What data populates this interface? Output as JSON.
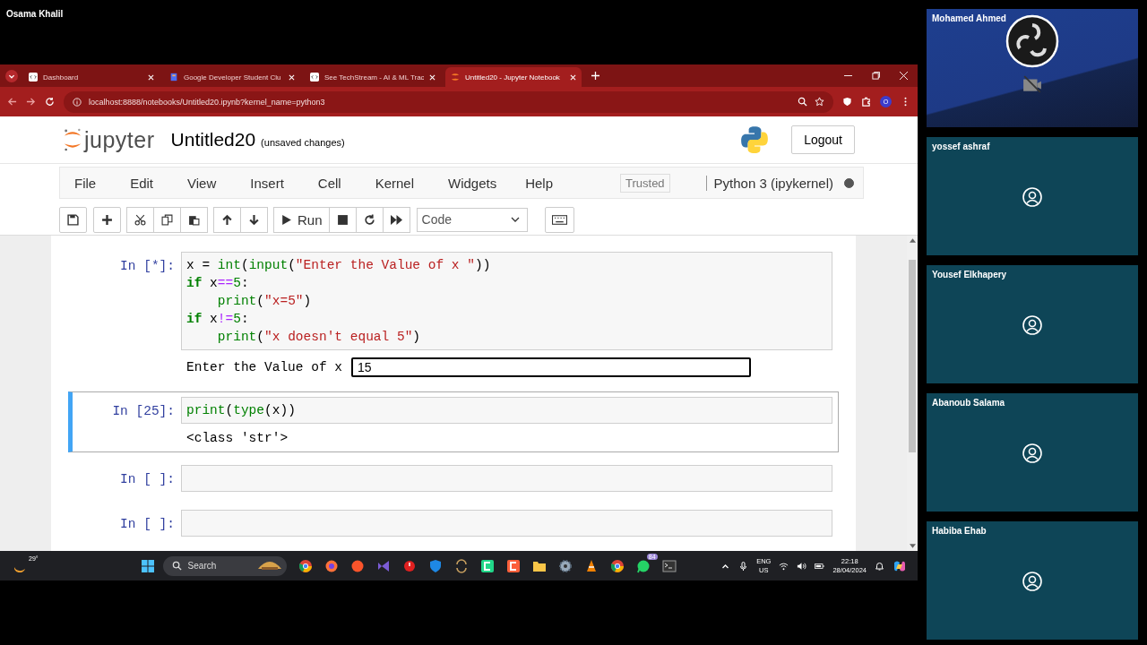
{
  "presenter": {
    "name": "Osama Khalil"
  },
  "browser": {
    "tabs": [
      {
        "title": "Dashboard",
        "kind": "code",
        "selected": false
      },
      {
        "title": "Google Developer Student Clu",
        "kind": "doc",
        "selected": false
      },
      {
        "title": "See TechStream - AI & ML Trac",
        "kind": "code",
        "selected": false
      },
      {
        "title": "Untitled20 - Jupyter Notebook",
        "kind": "jupyter",
        "selected": true
      }
    ],
    "url": "localhost:8888/notebooks/Untitled20.ipynb?kernel_name=python3",
    "profile_initial": "O"
  },
  "jupyter": {
    "brand": "jupyter",
    "notebook_title": "Untitled20",
    "save_status": "(unsaved changes)",
    "logout": "Logout",
    "menu": [
      "File",
      "Edit",
      "View",
      "Insert",
      "Cell",
      "Kernel",
      "Widgets",
      "Help"
    ],
    "trusted": "Trusted",
    "kernel": "Python 3 (ipykernel)",
    "kernel_busy": true,
    "run": "Run",
    "cell_type": "Code"
  },
  "cells": [
    {
      "prompt": "In [*]:",
      "selected": false,
      "code": [
        [
          {
            "text": "x = ",
            "kind": "plain"
          },
          {
            "text": "int",
            "kind": "builtin"
          },
          {
            "text": "(",
            "kind": "plain"
          },
          {
            "text": "input",
            "kind": "builtin"
          },
          {
            "text": "(",
            "kind": "plain"
          },
          {
            "text": "\"Enter the Value of x \"",
            "kind": "string"
          },
          {
            "text": "))",
            "kind": "plain"
          }
        ],
        [
          {
            "text": "if",
            "kind": "keyword"
          },
          {
            "text": " x",
            "kind": "plain"
          },
          {
            "text": "==",
            "kind": "operator"
          },
          {
            "text": "5",
            "kind": "number"
          },
          {
            "text": ":",
            "kind": "plain"
          }
        ],
        [
          {
            "text": "    print",
            "kind": "builtin"
          },
          {
            "text": "(",
            "kind": "plain"
          },
          {
            "text": "\"x=5\"",
            "kind": "string"
          },
          {
            "text": ")",
            "kind": "plain"
          }
        ],
        [
          {
            "text": "if",
            "kind": "keyword"
          },
          {
            "text": " x",
            "kind": "plain"
          },
          {
            "text": "!=",
            "kind": "operator"
          },
          {
            "text": "5",
            "kind": "number"
          },
          {
            "text": ":",
            "kind": "plain"
          }
        ],
        [
          {
            "text": "    print",
            "kind": "builtin"
          },
          {
            "text": "(",
            "kind": "plain"
          },
          {
            "text": "\"x doesn't equal 5\"",
            "kind": "string"
          },
          {
            "text": ")",
            "kind": "plain"
          }
        ]
      ],
      "stdin": {
        "prompt": "Enter the Value of x",
        "value": "15"
      }
    },
    {
      "prompt": "In [25]:",
      "selected": true,
      "code": [
        [
          {
            "text": "print",
            "kind": "builtin"
          },
          {
            "text": "(",
            "kind": "plain"
          },
          {
            "text": "type",
            "kind": "builtin"
          },
          {
            "text": "(x))",
            "kind": "plain"
          }
        ]
      ],
      "output": "<class 'str'>"
    },
    {
      "prompt": "In [ ]:",
      "selected": false
    },
    {
      "prompt": "In [ ]:",
      "selected": false
    }
  ],
  "taskbar": {
    "temperature": "29°",
    "search": "Search",
    "chat_badge": "84",
    "language": "ENG",
    "region": "US",
    "time": "22:18",
    "date": "28/04/2024"
  },
  "participants": [
    {
      "name": "Mohamed Ahmed",
      "kind": "logo",
      "camera_off": true
    },
    {
      "name": "yossef ashraf",
      "kind": "avatar",
      "camera_off": false
    },
    {
      "name": "Yousef Elkhapery",
      "kind": "avatar",
      "camera_off": false
    },
    {
      "name": "Abanoub Salama",
      "kind": "avatar",
      "camera_off": false
    },
    {
      "name": "Habiba Ehab",
      "kind": "avatar",
      "camera_off": false
    }
  ]
}
